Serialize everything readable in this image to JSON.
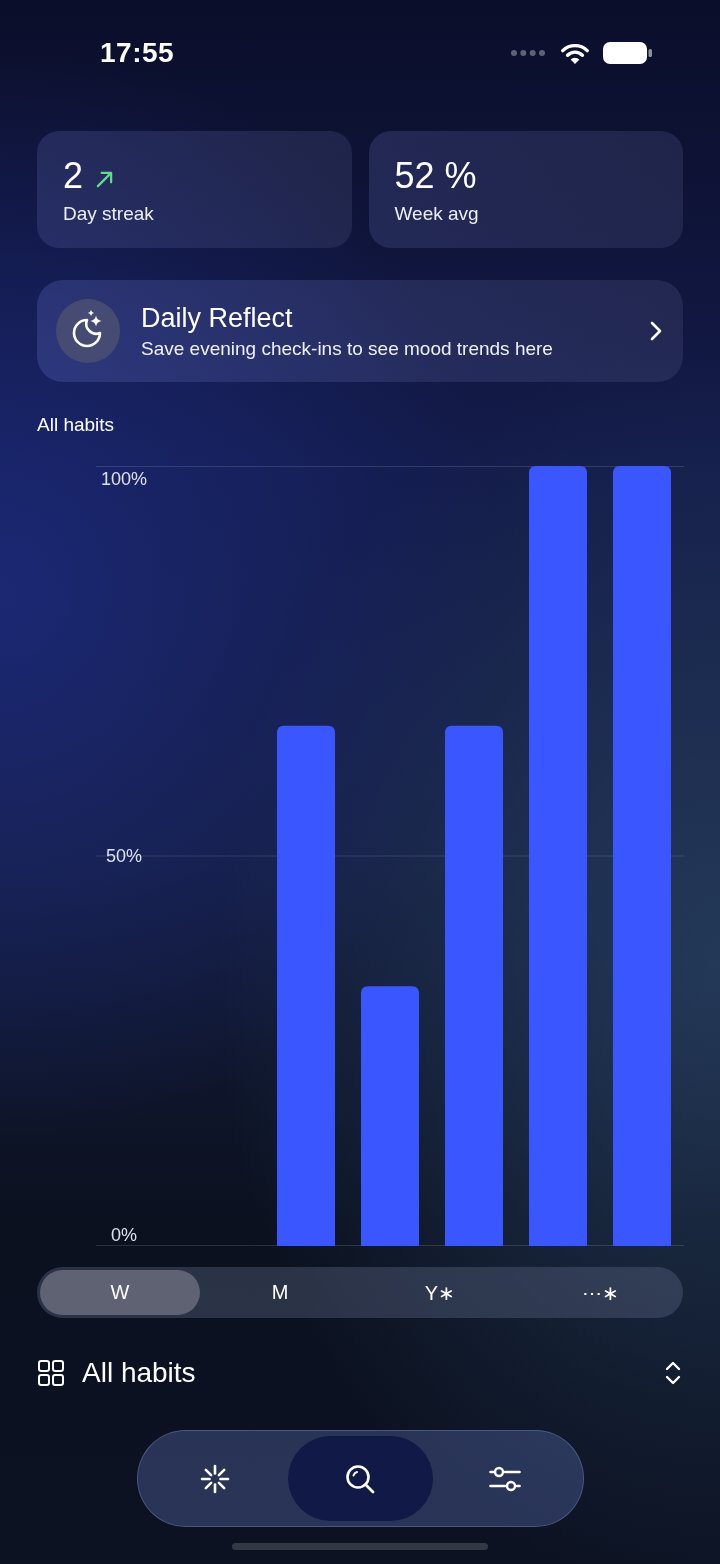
{
  "status_bar": {
    "time": "17:55"
  },
  "stats": [
    {
      "value": "2",
      "label": "Day streak",
      "trending_up": true
    },
    {
      "value": "52 %",
      "label": "Week avg",
      "trending_up": false
    }
  ],
  "reflect_card": {
    "title": "Daily Reflect",
    "subtitle": "Save evening check-ins to see mood trends here"
  },
  "chart_section": {
    "title": "All habits",
    "chart_data": {
      "type": "bar",
      "values": [
        0,
        0,
        66.7,
        33.3,
        66.7,
        100,
        100
      ],
      "ylim": [
        0,
        100
      ],
      "yticks": [
        {
          "value": 0,
          "label": "0%"
        },
        {
          "value": 50,
          "label": "50%"
        },
        {
          "value": 100,
          "label": "100%"
        }
      ]
    }
  },
  "range_tabs": [
    {
      "label": "W",
      "selected": true
    },
    {
      "label": "M",
      "selected": false
    },
    {
      "label": "Y∗",
      "selected": false
    },
    {
      "label": "⋯∗",
      "selected": false
    }
  ],
  "filter": {
    "label": "All habits"
  },
  "tab_bar": [
    {
      "kind": "sparkle",
      "selected": false
    },
    {
      "kind": "search",
      "selected": true
    },
    {
      "kind": "sliders",
      "selected": false
    }
  ]
}
